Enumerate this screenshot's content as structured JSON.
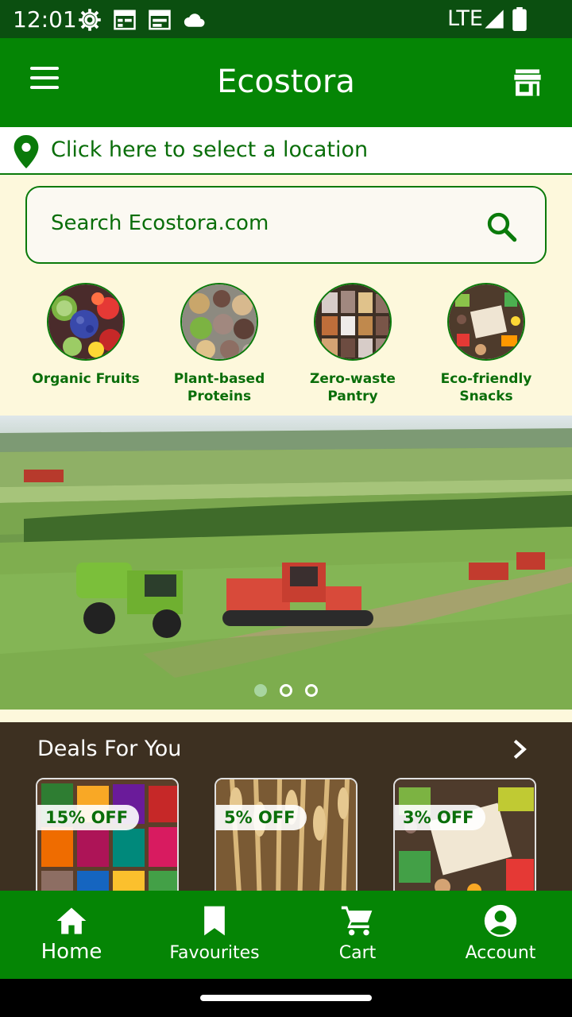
{
  "status_bar": {
    "time": "12:01",
    "network": "LTE"
  },
  "app_bar": {
    "title": "Ecostora"
  },
  "location": {
    "text": "Click here to select a location"
  },
  "search": {
    "placeholder": "Search Ecostora.com"
  },
  "categories": [
    {
      "label": "Organic Fruits"
    },
    {
      "label": "Plant-based Proteins"
    },
    {
      "label": "Zero-waste Pantry"
    },
    {
      "label": "Eco-friendly Snacks"
    }
  ],
  "banner": {
    "slides": 3,
    "active_slide": 1
  },
  "deals": {
    "title": "Deals For You",
    "items": [
      {
        "badge": "15% OFF"
      },
      {
        "badge": "5% OFF"
      },
      {
        "badge": "3% OFF"
      }
    ]
  },
  "bottom_nav": {
    "items": [
      {
        "label": "Home",
        "icon": "home-icon",
        "active": true
      },
      {
        "label": "Favourites",
        "icon": "bookmark-icon",
        "active": false
      },
      {
        "label": "Cart",
        "icon": "cart-icon",
        "active": false
      },
      {
        "label": "Account",
        "icon": "account-icon",
        "active": false
      }
    ]
  },
  "colors": {
    "primary": "#058505",
    "status_bar": "#0b4f10",
    "background": "#fdf8dc",
    "deals_bg": "#3d3021",
    "text_green": "#0a6e0a"
  }
}
